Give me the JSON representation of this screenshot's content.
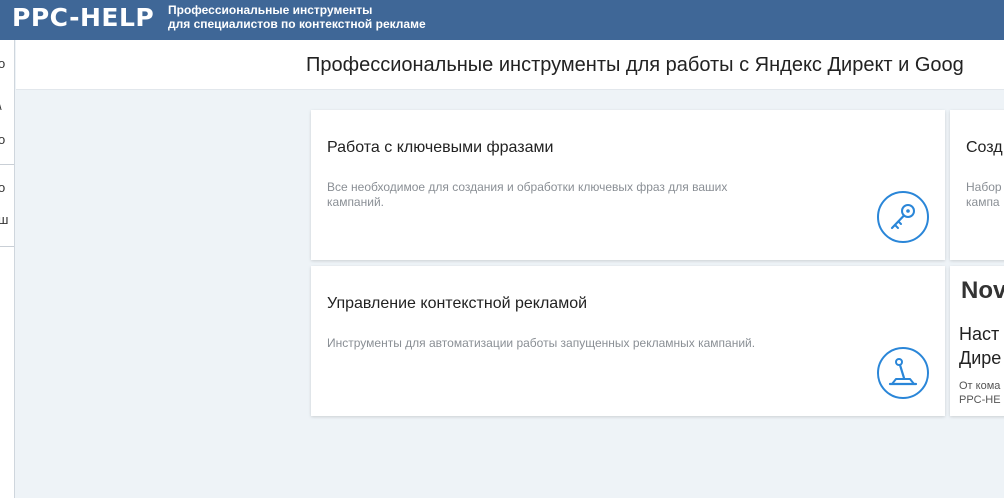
{
  "header": {
    "logo": "PPC-HELP",
    "tagline_line1": "Профессиональные инструменты",
    "tagline_line2": "для специалистов по контекстной рекламе"
  },
  "sidebar": {
    "fragments": [
      "о",
      "\\",
      "о",
      "о",
      "ш"
    ]
  },
  "page": {
    "title": "Профессиональные инструменты для работы с Яндекс Директ и Goog"
  },
  "cards": [
    {
      "title": "Работа с ключевыми фразами",
      "description": "Все необходимое для создания и обработки ключевых фраз для ваших кампаний.",
      "icon": "key-icon"
    },
    {
      "title": "Управление контекстной рекламой",
      "description": "Инструменты для автоматизации работы запущенных рекламных кампаний.",
      "icon": "joystick-icon"
    }
  ],
  "partial_card": {
    "title": "Созд",
    "desc_line1": "Набор",
    "desc_line2": "кампа"
  },
  "news": {
    "tag": "Nov",
    "title_line1": "Наст",
    "title_line2": "Дире",
    "meta_line1": "От кома",
    "meta_line2": "PPC-HE"
  },
  "colors": {
    "header_bg": "#3f6797",
    "page_bg": "#eef3f7",
    "icon_blue": "#2a86d8"
  }
}
